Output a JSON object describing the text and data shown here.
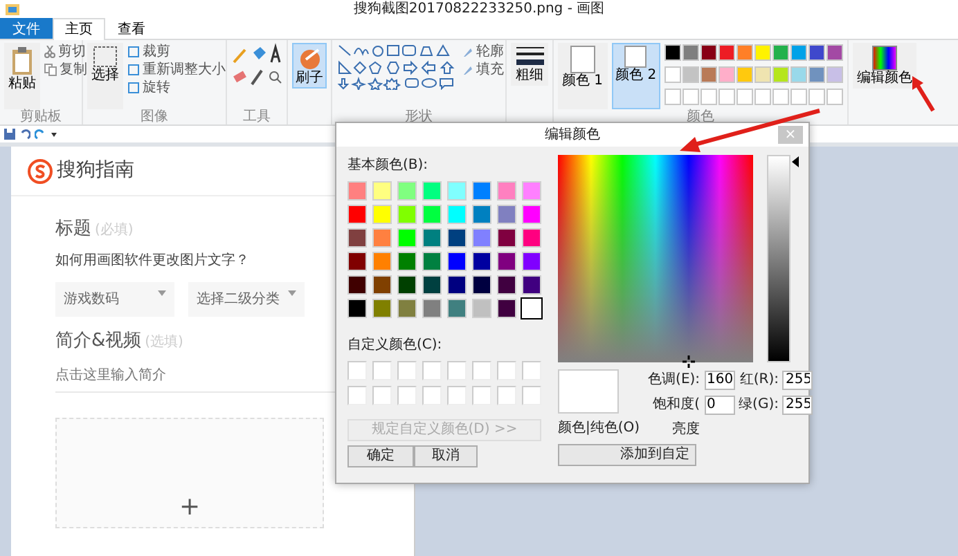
{
  "window": {
    "title": "搜狗截图20170822233250.png - 画图"
  },
  "tabs": [
    {
      "label": "文件",
      "kind": "file",
      "selected": false
    },
    {
      "label": "主页",
      "kind": "tab",
      "selected": true
    },
    {
      "label": "查看",
      "kind": "tab",
      "selected": false
    }
  ],
  "ribbon": {
    "clipboard": {
      "paste": "粘贴",
      "cut": "剪切",
      "copy": "复制",
      "group": "剪贴板"
    },
    "image": {
      "select": "选择",
      "crop": "裁剪",
      "resize": "重新调整大小",
      "rotate": "旋转",
      "group": "图像"
    },
    "tools": {
      "group": "工具"
    },
    "brush": {
      "label": "刷子",
      "selected": true
    },
    "shapes": {
      "outline": "轮廓",
      "fill": "填充",
      "group": "形状"
    },
    "size": {
      "label": "粗细"
    },
    "colors": {
      "color1": "颜色 1",
      "color2": "颜色 2",
      "color2_selected": true,
      "group": "颜色",
      "palette": [
        {
          "color": "#000000"
        },
        {
          "color": "#7f7f7f"
        },
        {
          "color": "#880015"
        },
        {
          "color": "#ed1c24"
        },
        {
          "color": "#ff7f27"
        },
        {
          "color": "#fff200"
        },
        {
          "color": "#22b14c"
        },
        {
          "color": "#00a2e8"
        },
        {
          "color": "#3f48cc"
        },
        {
          "color": "#a349a4"
        },
        {
          "color": "#ffffff"
        },
        {
          "color": "#c3c3c3"
        },
        {
          "color": "#b97a57"
        },
        {
          "color": "#ffaec9"
        },
        {
          "color": "#ffc90e"
        },
        {
          "color": "#efe4b0"
        },
        {
          "color": "#b5e61d"
        },
        {
          "color": "#99d9ea"
        },
        {
          "color": "#7092be"
        },
        {
          "color": "#c8bfe7"
        }
      ],
      "empty_slots_shown": true
    },
    "edit_colors": {
      "label": "编辑颜色"
    }
  },
  "page": {
    "logo": "搜狗指南",
    "title_label": "标题",
    "title_hint": "(必填)",
    "title_value": "如何用画图软件更改图片文字？",
    "dropdowns": [
      "游戏数码",
      "选择二级分类"
    ],
    "intro_label": "简介&视频",
    "intro_hint": "(选填)",
    "intro_placeholder": "点击这里输入简介",
    "upload": "+"
  },
  "dialog": {
    "title": "编辑颜色",
    "close": "×",
    "basic_label": "基本颜色(B):",
    "basic_colors": [
      {
        "color": "#ff8080",
        "selected": false
      },
      {
        "color": "#ffff80",
        "selected": false
      },
      {
        "color": "#80ff80",
        "selected": false
      },
      {
        "color": "#00ff80",
        "selected": false
      },
      {
        "color": "#80ffff",
        "selected": false
      },
      {
        "color": "#0080ff",
        "selected": false
      },
      {
        "color": "#ff80c0",
        "selected": false
      },
      {
        "color": "#ff80ff",
        "selected": false
      },
      {
        "color": "#ff0000",
        "selected": false
      },
      {
        "color": "#ffff00",
        "selected": false
      },
      {
        "color": "#80ff00",
        "selected": false
      },
      {
        "color": "#00ff40",
        "selected": false
      },
      {
        "color": "#00ffff",
        "selected": false
      },
      {
        "color": "#0080c0",
        "selected": false
      },
      {
        "color": "#8080c0",
        "selected": false
      },
      {
        "color": "#ff00ff",
        "selected": false
      },
      {
        "color": "#804040",
        "selected": false
      },
      {
        "color": "#ff8040",
        "selected": false
      },
      {
        "color": "#00ff00",
        "selected": false
      },
      {
        "color": "#008080",
        "selected": false
      },
      {
        "color": "#004080",
        "selected": false
      },
      {
        "color": "#8080ff",
        "selected": false
      },
      {
        "color": "#800040",
        "selected": false
      },
      {
        "color": "#ff0080",
        "selected": false
      },
      {
        "color": "#800000",
        "selected": false
      },
      {
        "color": "#ff8000",
        "selected": false
      },
      {
        "color": "#008000",
        "selected": false
      },
      {
        "color": "#008040",
        "selected": false
      },
      {
        "color": "#0000ff",
        "selected": false
      },
      {
        "color": "#0000a0",
        "selected": false
      },
      {
        "color": "#800080",
        "selected": false
      },
      {
        "color": "#8000ff",
        "selected": false
      },
      {
        "color": "#400000",
        "selected": false
      },
      {
        "color": "#804000",
        "selected": false
      },
      {
        "color": "#004000",
        "selected": false
      },
      {
        "color": "#004040",
        "selected": false
      },
      {
        "color": "#000080",
        "selected": false
      },
      {
        "color": "#000040",
        "selected": false
      },
      {
        "color": "#400040",
        "selected": false
      },
      {
        "color": "#400080",
        "selected": false
      },
      {
        "color": "#000000",
        "selected": false
      },
      {
        "color": "#808000",
        "selected": false
      },
      {
        "color": "#808040",
        "selected": false
      },
      {
        "color": "#808080",
        "selected": false
      },
      {
        "color": "#408080",
        "selected": false
      },
      {
        "color": "#c0c0c0",
        "selected": false
      },
      {
        "color": "#400040",
        "selected": false
      },
      {
        "color": "#ffffff",
        "selected": true
      }
    ],
    "custom_label": "自定义颜色(C):",
    "define_button": {
      "label": "规定自定义颜色(D) >>",
      "disabled": true
    },
    "ok": "确定",
    "cancel": "取消",
    "luminance": {
      "level": 1
    },
    "preview_label": "颜色|纯色(O)",
    "fields": [
      {
        "label": "色调(E):",
        "value": "160"
      },
      {
        "label": "红(R):",
        "value": "255"
      },
      {
        "label": "饱和度(",
        "value": "0"
      },
      {
        "label": "绿(G):",
        "value": "255"
      }
    ],
    "luminance_label": "亮度",
    "add_button": "添加到自定"
  }
}
